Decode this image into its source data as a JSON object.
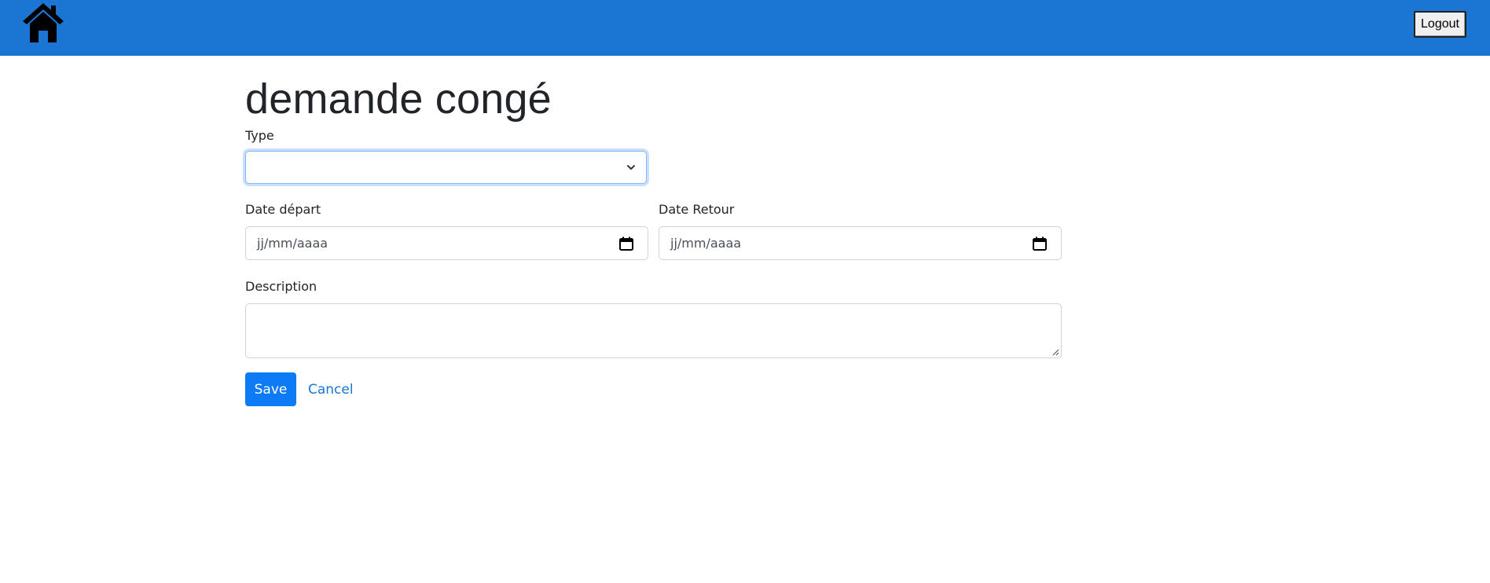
{
  "header": {
    "home_icon": "home-icon",
    "logout_label": "Logout",
    "bar_color": "#1b76d3"
  },
  "form": {
    "title": "demande congé",
    "type": {
      "label": "Type",
      "selected_value": ""
    },
    "date_depart": {
      "label": "Date départ",
      "placeholder": "jj/mm/aaaa",
      "icon": "calendar-icon"
    },
    "date_retour": {
      "label": "Date Retour",
      "placeholder": "jj/mm/aaaa",
      "icon": "calendar-icon"
    },
    "description": {
      "label": "Description",
      "value": ""
    },
    "save_label": "Save",
    "cancel_label": "Cancel",
    "accent_color": "#0d7bf5"
  }
}
